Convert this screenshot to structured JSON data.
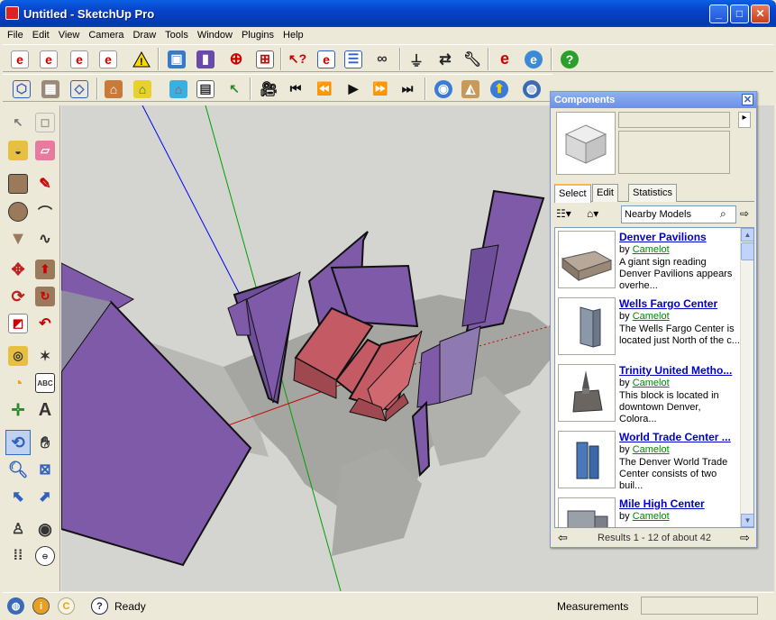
{
  "window": {
    "title": "Untitled - SketchUp Pro",
    "min": "_",
    "max": "□",
    "close": "✕"
  },
  "menu": [
    "File",
    "Edit",
    "View",
    "Camera",
    "Draw",
    "Tools",
    "Window",
    "Plugins",
    "Help"
  ],
  "colors": {
    "titlebar": "#0842c8",
    "face_purple": "#7f5aa8",
    "face_red": "#c45a64",
    "sky": "#d4d4d0",
    "axis_blue": "#0000ff",
    "axis_green": "#00a000",
    "axis_red": "#cc0000"
  },
  "toolbar1_icons": [
    "ie-icon",
    "ie-icon",
    "ie-icon",
    "ie-icon",
    "warning-icon",
    "component-icon",
    "component-icon",
    "target-icon",
    "grid-icon",
    "select-help-icon",
    "ie-window-icon",
    "window-icon",
    "binoculars-icon",
    "plug-icon",
    "arrows-icon",
    "wrench-icon",
    "ie-e-icon",
    "ie-globe-icon",
    "help-icon"
  ],
  "toolbar2_icons": [
    "iso-view-icon",
    "top-view-icon",
    "front-view-icon",
    "house-icon",
    "house-color-icon",
    "house-color-icon",
    "table-icon",
    "cursor-color-icon",
    "camera-icon",
    "first-scene-icon",
    "prev-scene-icon",
    "play-icon",
    "next-scene-icon",
    "last-scene-icon",
    "get-models-icon",
    "share-model-icon",
    "upload-icon",
    "earth-icon",
    "download-icon"
  ],
  "status": {
    "ready": "Ready",
    "measurements_label": "Measurements"
  },
  "components": {
    "title": "Components",
    "tabs": [
      "Select",
      "Edit",
      "Statistics"
    ],
    "search_value": "Nearby Models",
    "results_text": "Results 1 - 12 of about 42",
    "items": [
      {
        "title": "Denver Pavilions",
        "by": "by",
        "author": "Camelot",
        "desc": "A giant sign reading Denver Pavilions appears overhe..."
      },
      {
        "title": "Wells Fargo Center",
        "by": "by",
        "author": "Camelot",
        "desc": "The Wells Fargo Center is located just North of the c..."
      },
      {
        "title": "Trinity United Metho...",
        "by": "by",
        "author": "Camelot",
        "desc": "This block is located in downtown Denver, Colora..."
      },
      {
        "title": "World Trade Center ...",
        "by": "by",
        "author": "Camelot",
        "desc": "The Denver World Trade Center consists of two buil..."
      },
      {
        "title": "Mile High Center",
        "by": "by",
        "author": "Camelot",
        "desc": ""
      }
    ]
  }
}
